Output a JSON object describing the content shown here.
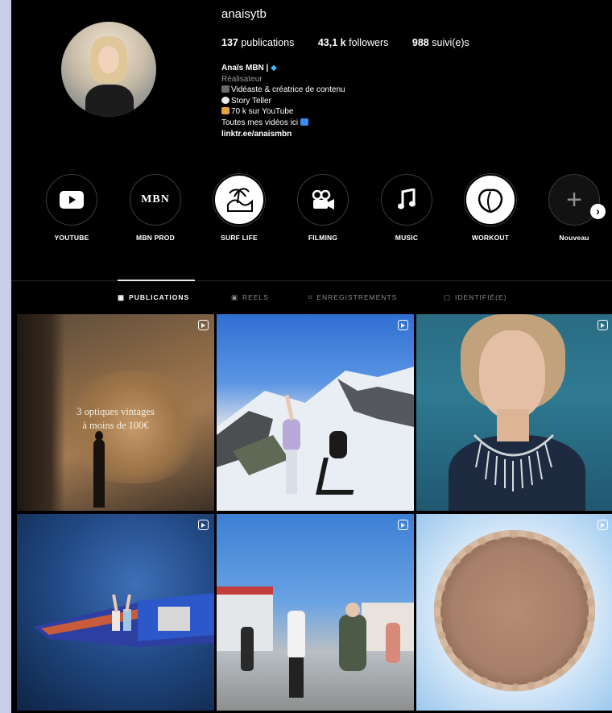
{
  "profile": {
    "username": "anaisytb",
    "stats": {
      "publications_count": "137",
      "publications_label": "publications",
      "followers_count": "43,1 k",
      "followers_label": "followers",
      "following_count": "988",
      "following_label": "suivi(e)s"
    },
    "bio": {
      "name": "Anaïs MBN |",
      "category": "Réalisateur",
      "line1": "Vidéaste & créatrice de contenu",
      "line2": "Story Teller",
      "line3": "70 k sur YouTube",
      "line4": "Toutes mes vidéos ici",
      "link": "linktr.ee/anaismbn"
    }
  },
  "highlights": [
    {
      "label": "YOUTUBE",
      "icon": "youtube-play-icon"
    },
    {
      "label": "MBN PROD",
      "icon": "mbn-logo",
      "logo_text": "MBN"
    },
    {
      "label": "SURF LIFE",
      "icon": "palm-wave-icon"
    },
    {
      "label": "FILMING",
      "icon": "movie-camera-icon"
    },
    {
      "label": "MUSIC",
      "icon": "music-note-icon"
    },
    {
      "label": "WORKOUT",
      "icon": "peach-icon"
    },
    {
      "label": "Nouveau",
      "icon": "plus-icon"
    }
  ],
  "tabs": [
    {
      "label": "PUBLICATIONS",
      "icon": "grid-icon",
      "active": true
    },
    {
      "label": "REELS",
      "icon": "reels-icon",
      "active": false
    },
    {
      "label": "ENREGISTREMENTS",
      "icon": "bookmark-icon",
      "active": false
    },
    {
      "label": "IDENTIFIÉ(E)",
      "icon": "tag-icon",
      "active": false
    }
  ],
  "posts": [
    {
      "type": "reel",
      "caption_line1": "3 optiques vintages",
      "caption_line2": "à moins de 100€"
    },
    {
      "type": "reel"
    },
    {
      "type": "reel"
    },
    {
      "type": "reel"
    },
    {
      "type": "reel"
    },
    {
      "type": "reel"
    }
  ],
  "colors": {
    "background": "#000000",
    "outer_background": "#c9cde6",
    "muted_text": "#8e8e8e",
    "verified_gem": "#3fb8ff"
  }
}
